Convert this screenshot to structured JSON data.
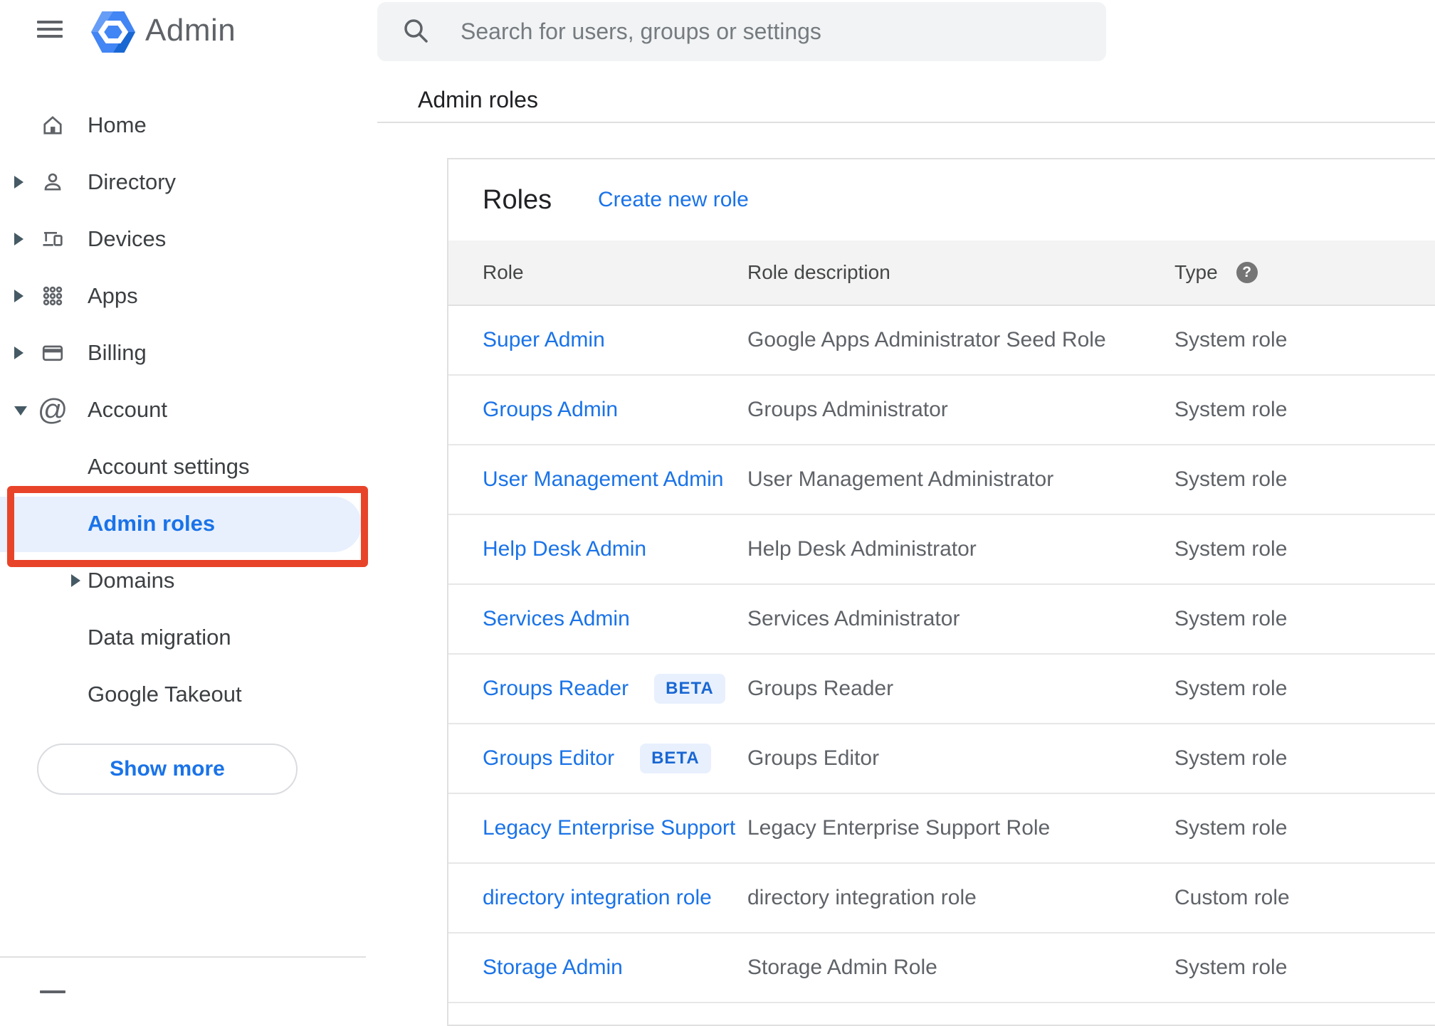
{
  "header": {
    "app_title": "Admin",
    "search_placeholder": "Search for users, groups or settings"
  },
  "breadcrumb": "Admin roles",
  "sidebar": {
    "items": [
      {
        "label": "Home",
        "icon": "home",
        "arrow": "none",
        "level": 0
      },
      {
        "label": "Directory",
        "icon": "person",
        "arrow": "right",
        "level": 0
      },
      {
        "label": "Devices",
        "icon": "devices",
        "arrow": "right",
        "level": 0
      },
      {
        "label": "Apps",
        "icon": "apps",
        "arrow": "right",
        "level": 0
      },
      {
        "label": "Billing",
        "icon": "card",
        "arrow": "right",
        "level": 0
      },
      {
        "label": "Account",
        "icon": "at",
        "arrow": "down",
        "level": 0
      },
      {
        "label": "Account settings",
        "icon": null,
        "arrow": "none",
        "level": 1
      },
      {
        "label": "Admin roles",
        "icon": null,
        "arrow": "none",
        "level": 1,
        "active": true,
        "annotated": true
      },
      {
        "label": "Domains",
        "icon": null,
        "arrow": "right",
        "level": 1
      },
      {
        "label": "Data migration",
        "icon": null,
        "arrow": "none",
        "level": 1
      },
      {
        "label": "Google Takeout",
        "icon": null,
        "arrow": "none",
        "level": 1
      }
    ],
    "show_more_label": "Show more"
  },
  "roles_card": {
    "title": "Roles",
    "create_link": "Create new role",
    "columns": [
      "Role",
      "Role description",
      "Type"
    ],
    "beta_label": "BETA",
    "help_glyph": "?",
    "rows": [
      {
        "role": "Super Admin",
        "beta": false,
        "description": "Google Apps Administrator Seed Role",
        "type": "System role"
      },
      {
        "role": "Groups Admin",
        "beta": false,
        "description": "Groups Administrator",
        "type": "System role"
      },
      {
        "role": "User Management Admin",
        "beta": false,
        "description": "User Management Administrator",
        "type": "System role"
      },
      {
        "role": "Help Desk Admin",
        "beta": false,
        "description": "Help Desk Administrator",
        "type": "System role"
      },
      {
        "role": "Services Admin",
        "beta": false,
        "description": "Services Administrator",
        "type": "System role"
      },
      {
        "role": "Groups Reader",
        "beta": true,
        "description": "Groups Reader",
        "type": "System role"
      },
      {
        "role": "Groups Editor",
        "beta": true,
        "description": "Groups Editor",
        "type": "System role"
      },
      {
        "role": "Legacy Enterprise Support",
        "beta": false,
        "description": "Legacy Enterprise Support Role",
        "type": "System role"
      },
      {
        "role": "directory integration role",
        "beta": false,
        "description": "directory integration role",
        "type": "Custom role"
      },
      {
        "role": "Storage Admin",
        "beta": false,
        "description": "Storage Admin Role",
        "type": "System role"
      }
    ]
  },
  "colors": {
    "accent_blue": "#1a73e8",
    "active_item_bg": "#e8f0fe",
    "annotation_red": "#e8442a",
    "beta_badge_bg": "#e8f0fe",
    "beta_badge_text": "#1967d2",
    "header_band_bg": "#f3f3f3",
    "logo_blue": "#4285f4"
  }
}
